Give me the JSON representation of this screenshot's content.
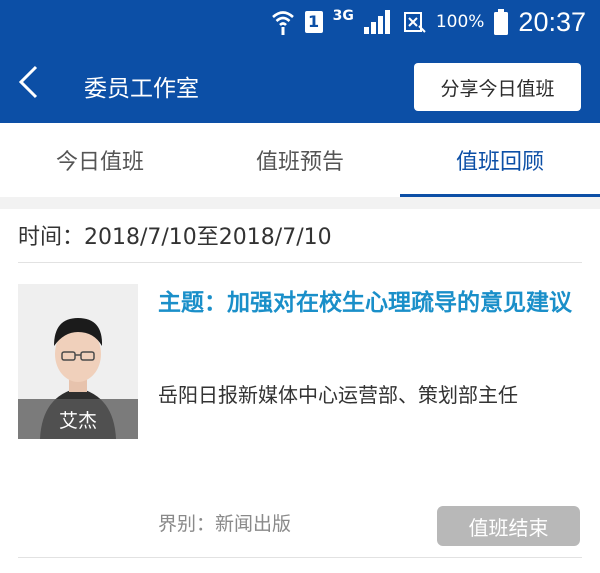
{
  "status_bar": {
    "sim_slot": "1",
    "network_type": "3G",
    "battery_percent": "100%",
    "time": "20:37",
    "icons": [
      "wifi-icon",
      "sim-icon",
      "signal-icon",
      "no-sim-icon",
      "battery-icon"
    ]
  },
  "header": {
    "title": "委员工作室",
    "share_button": "分享今日值班",
    "back_icon": "back-icon",
    "background_color": "#0c4fa6"
  },
  "tabs": [
    {
      "label": "今日值班",
      "active": false
    },
    {
      "label": "值班预告",
      "active": false
    },
    {
      "label": "值班回顾",
      "active": true
    }
  ],
  "time_range": "时间：2018/7/10至2018/7/10",
  "card": {
    "name": "艾杰",
    "topic": "主题：加强对在校生心理疏导的意见建议",
    "org": "岳阳日报新媒体中心运营部、策划部主任",
    "field": "界别：新闻出版",
    "status": "值班结束",
    "topic_color": "#1a8fc9"
  }
}
